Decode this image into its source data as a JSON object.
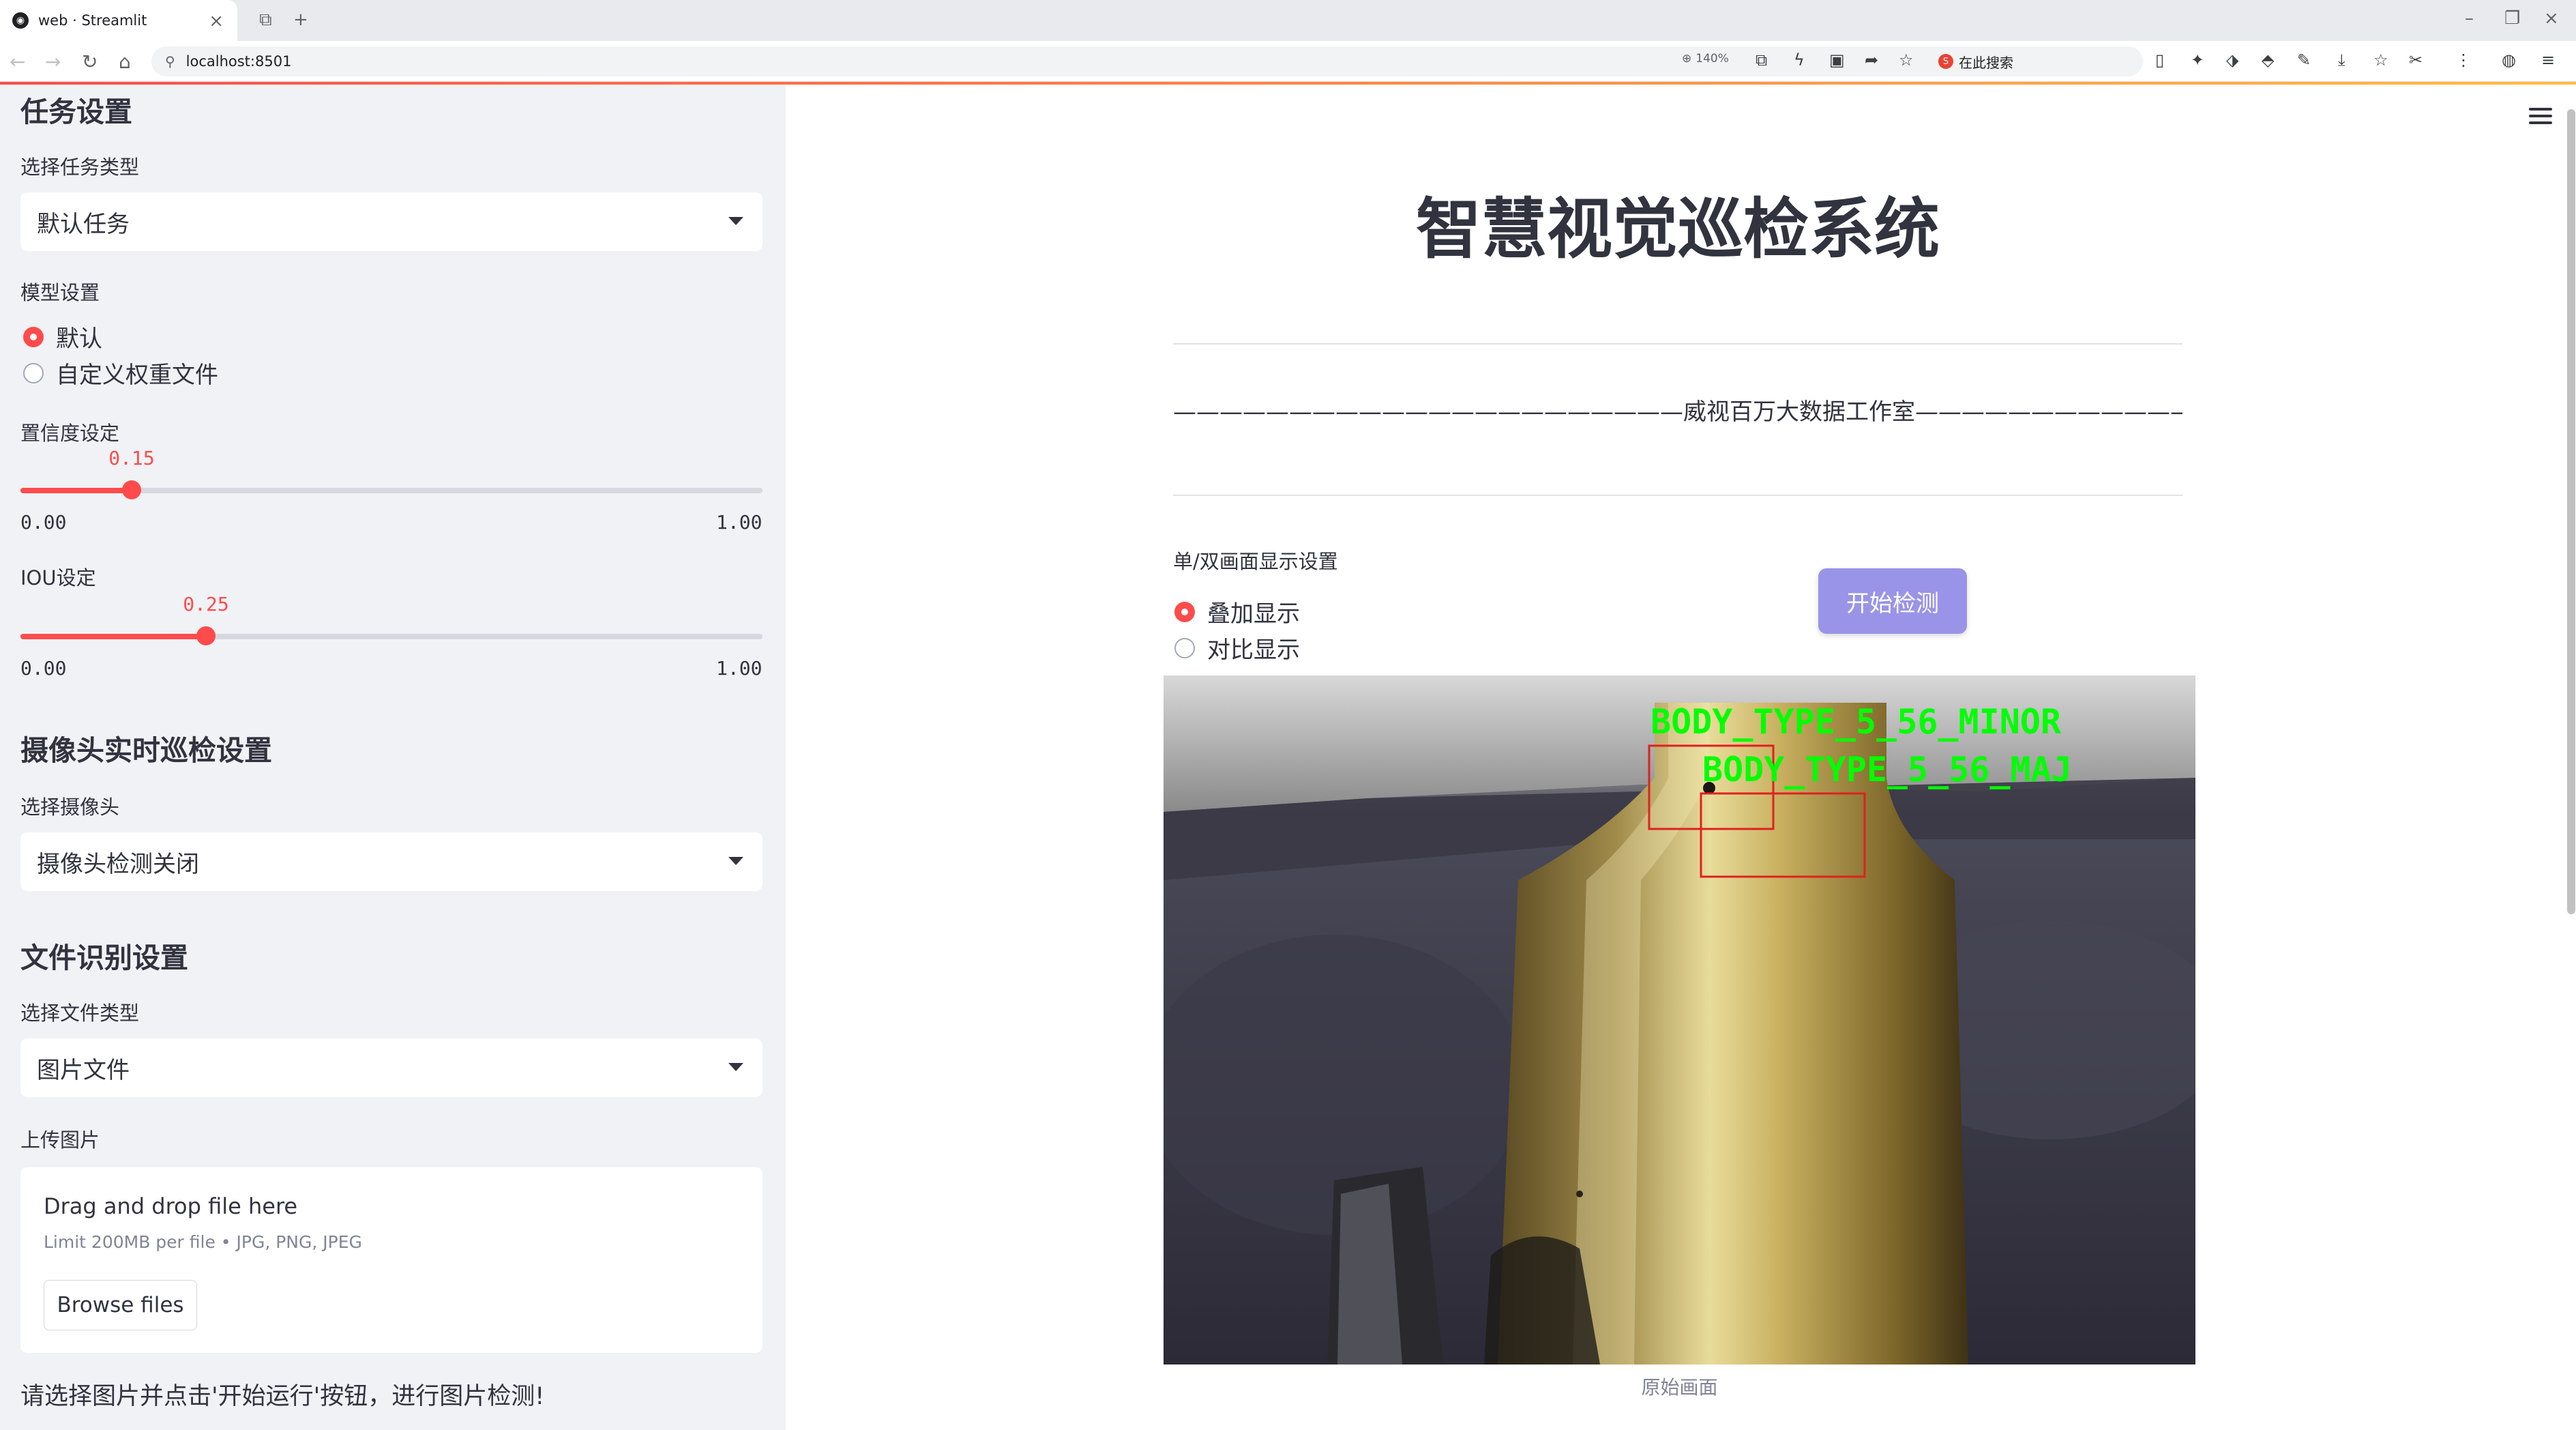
{
  "browser": {
    "tab_title": "web · Streamlit",
    "url": "localhost:8501",
    "zoom": "140%",
    "search_placeholder": "在此搜索"
  },
  "sidebar": {
    "task_heading": "任务设置",
    "task_type_label": "选择任务类型",
    "task_type_value": "默认任务",
    "model_label": "模型设置",
    "model_options": [
      "默认",
      "自定义权重文件"
    ],
    "model_selected": 0,
    "conf_label": "置信度设定",
    "conf": {
      "value": 0.15,
      "value_text": "0.15",
      "min": "0.00",
      "max": "1.00"
    },
    "iou_label": "IOU设定",
    "iou": {
      "value": 0.25,
      "value_text": "0.25",
      "min": "0.00",
      "max": "1.00"
    },
    "camera_heading": "摄像头实时巡检设置",
    "camera_label": "选择摄像头",
    "camera_value": "摄像头检测关闭",
    "file_heading": "文件识别设置",
    "file_type_label": "选择文件类型",
    "file_type_value": "图片文件",
    "upload_label": "上传图片",
    "uploader": {
      "title": "Drag and drop file here",
      "limit": "Limit 200MB per file • JPG, PNG, JPEG",
      "browse": "Browse files"
    },
    "note": "请选择图片并点击'开始运行'按钮，进行图片检测!"
  },
  "main": {
    "title": "智慧视觉巡检系统",
    "subtitle": "——————————————————————威视百万大数据工作室———————————————————————",
    "display_label": "单/双画面显示设置",
    "display_options": [
      "叠加显示",
      "对比显示"
    ],
    "display_selected": 0,
    "start_button": "开始检测",
    "detections": [
      "BODY_TYPE_5_56_MINOR",
      "BODY_TYPE_5_56_MAJ"
    ],
    "caption": "原始画面"
  },
  "colors": {
    "accent": "#ff4b4b",
    "button": "#9a94e8",
    "sidebar_bg": "#f0f2f6",
    "detection_label": "#00ff00",
    "detection_box": "#e02020"
  }
}
